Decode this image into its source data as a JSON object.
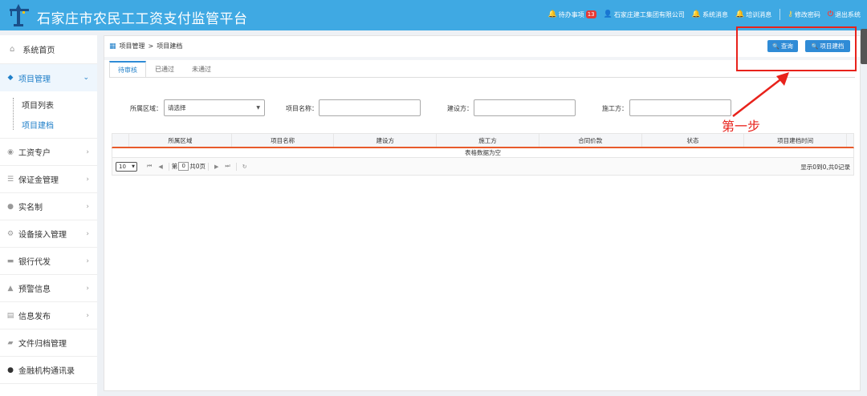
{
  "header": {
    "title": "石家庄市农民工工资支付监管平台",
    "todo_label": "待办事项",
    "todo_count": "13",
    "company": "石家庄建工集团有限公司",
    "system_msg": "系统消息",
    "training_msg": "培训消息",
    "change_password": "修改密码",
    "logout": "退出系统"
  },
  "sidebar": {
    "home": "系统首页",
    "project_mgmt": "项目管理",
    "sub_items": [
      "项目列表",
      "项目建档"
    ],
    "groups": [
      "工资专户",
      "保证金管理",
      "实名制",
      "设备接入管理",
      "银行代发",
      "预警信息",
      "信息发布",
      "文件归档管理",
      "金融机构通讯录"
    ]
  },
  "breadcrumb": {
    "level1": "项目管理",
    "sep": ">",
    "level2": "项目建档"
  },
  "buttons": {
    "query": "查询",
    "create": "项目建档"
  },
  "tabs": [
    "待审核",
    "已通过",
    "未通过"
  ],
  "filters": {
    "region_label": "所属区域：",
    "region_value": "请选择",
    "project_name_label": "项目名称：",
    "builder_label": "建设方：",
    "contractor_label": "施工方："
  },
  "table": {
    "columns": [
      "所属区域",
      "项目名称",
      "建设方",
      "施工方",
      "合同价款",
      "状态",
      "项目建档时间"
    ],
    "empty_text": "表格数据为空",
    "page_size": "10",
    "page_prefix": "第",
    "page_value": "0",
    "page_total": "共0页",
    "info": "显示0到0,共0记录"
  },
  "annotation": {
    "text": "第一步"
  },
  "colors": {
    "topbar": "#3fa9e3",
    "accent": "#2f8bd6",
    "annotation": "#e8221b"
  }
}
